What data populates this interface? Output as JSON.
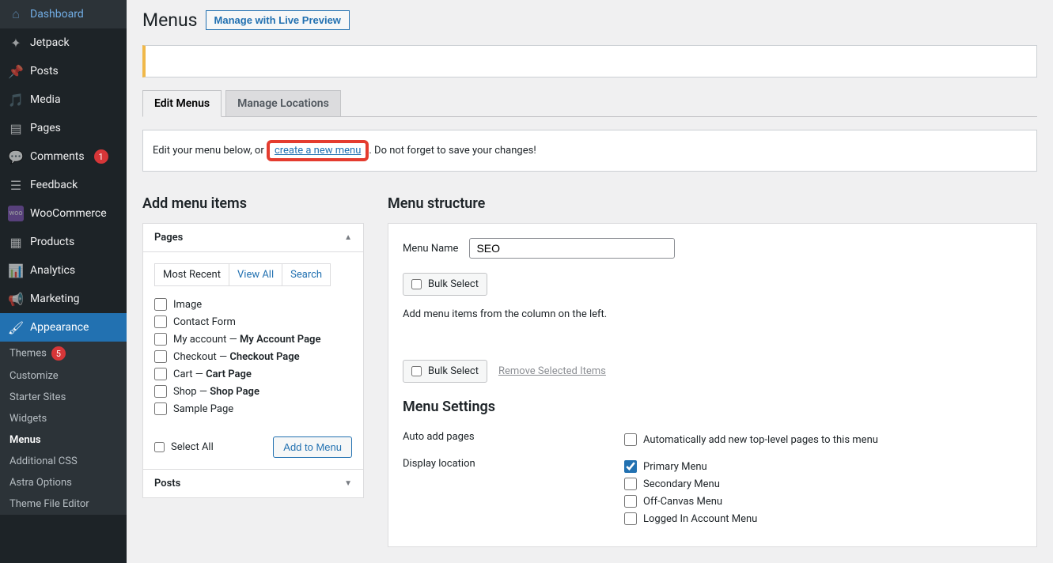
{
  "sidebar": {
    "items": [
      {
        "icon": "dashboard",
        "label": "Dashboard"
      },
      {
        "icon": "jetpack",
        "label": "Jetpack"
      },
      {
        "icon": "pin",
        "label": "Posts"
      },
      {
        "icon": "media",
        "label": "Media"
      },
      {
        "icon": "page",
        "label": "Pages"
      },
      {
        "icon": "comment",
        "label": "Comments",
        "badge": "1"
      },
      {
        "icon": "feedback",
        "label": "Feedback"
      },
      {
        "icon": "woo",
        "label": "WooCommerce"
      },
      {
        "icon": "product",
        "label": "Products"
      },
      {
        "icon": "analytics",
        "label": "Analytics"
      },
      {
        "icon": "marketing",
        "label": "Marketing"
      },
      {
        "icon": "appearance",
        "label": "Appearance",
        "active": true
      }
    ],
    "submenu": [
      {
        "label": "Themes",
        "badge": "5"
      },
      {
        "label": "Customize"
      },
      {
        "label": "Starter Sites"
      },
      {
        "label": "Widgets"
      },
      {
        "label": "Menus",
        "current": true
      },
      {
        "label": "Additional CSS"
      },
      {
        "label": "Astra Options"
      },
      {
        "label": "Theme File Editor"
      }
    ]
  },
  "header": {
    "title": "Menus",
    "preview_btn": "Manage with Live Preview"
  },
  "tabs": {
    "edit": "Edit Menus",
    "locations": "Manage Locations"
  },
  "info": {
    "prefix": "Edit your menu below, or ",
    "link": "create a new menu",
    "suffix": ". Do not forget to save your changes!"
  },
  "left": {
    "title": "Add menu items",
    "pages_label": "Pages",
    "subtabs": {
      "recent": "Most Recent",
      "all": "View All",
      "search": "Search"
    },
    "items": [
      {
        "label": "Image"
      },
      {
        "label": "Contact Form"
      },
      {
        "label": "My account",
        "sep": " — ",
        "bold": "My Account Page"
      },
      {
        "label": "Checkout",
        "sep": " — ",
        "bold": "Checkout Page"
      },
      {
        "label": "Cart",
        "sep": " — ",
        "bold": "Cart Page"
      },
      {
        "label": "Shop",
        "sep": " — ",
        "bold": "Shop Page"
      },
      {
        "label": "Sample Page"
      }
    ],
    "select_all": "Select All",
    "add_btn": "Add to Menu",
    "posts_label": "Posts"
  },
  "right": {
    "title": "Menu structure",
    "name_label": "Menu Name",
    "name_value": "SEO",
    "bulk_select": "Bulk Select",
    "hint": "Add menu items from the column on the left.",
    "remove_link": "Remove Selected Items",
    "settings_title": "Menu Settings",
    "auto_label": "Auto add pages",
    "auto_opt": "Automatically add new top-level pages to this menu",
    "loc_label": "Display location",
    "locations": [
      {
        "label": "Primary Menu",
        "checked": true
      },
      {
        "label": "Secondary Menu"
      },
      {
        "label": "Off-Canvas Menu"
      },
      {
        "label": "Logged In Account Menu"
      }
    ]
  }
}
